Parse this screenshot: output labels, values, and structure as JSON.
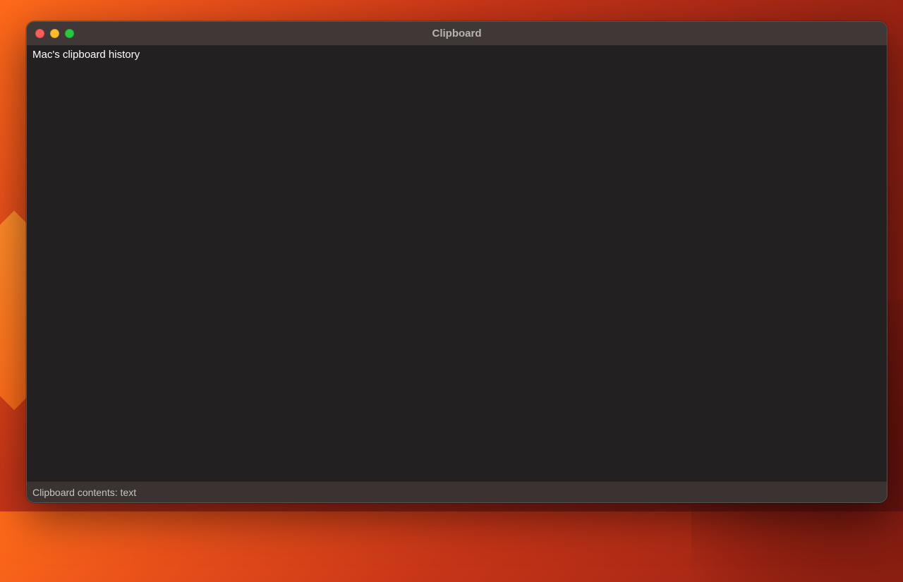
{
  "window": {
    "title": "Clipboard"
  },
  "content": {
    "text": "Mac's clipboard history"
  },
  "statusbar": {
    "label": "Clipboard contents: text"
  }
}
